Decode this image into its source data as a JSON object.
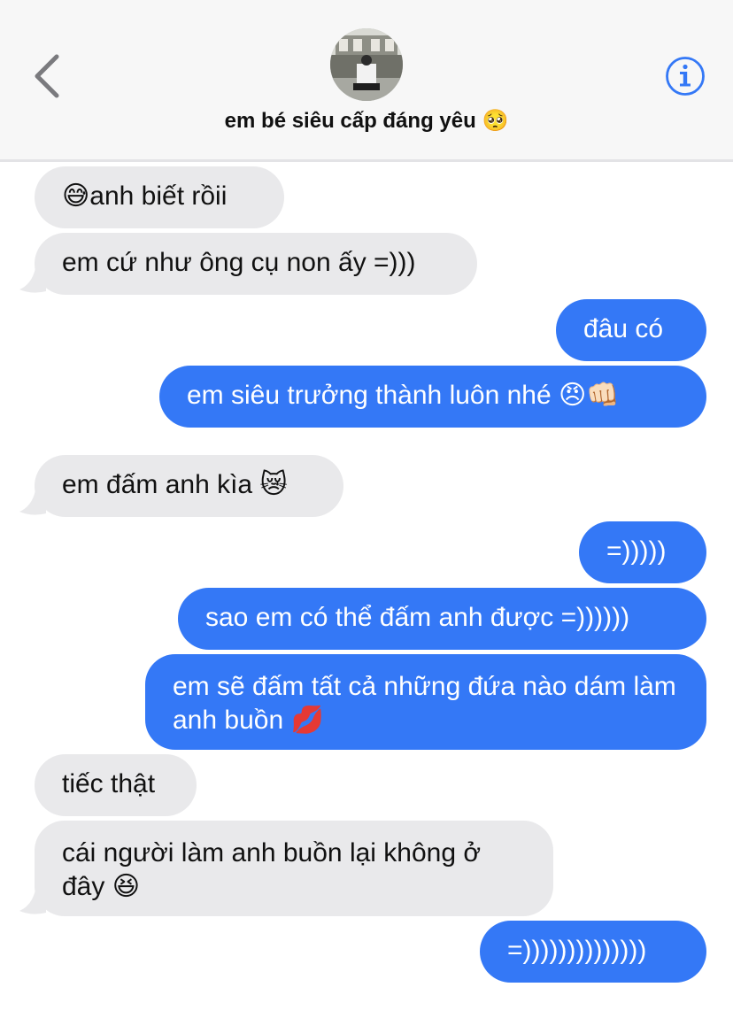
{
  "header": {
    "contact_name": "em bé siêu cấp đáng yêu 🥺",
    "back_icon": "chevron-left-icon",
    "info_icon": "info-icon",
    "accent_color": "#3478f6"
  },
  "messages": [
    {
      "from": "them",
      "text": "😅anh biết rồii"
    },
    {
      "from": "them",
      "text": "em cứ như ông cụ non ấy =)))"
    },
    {
      "from": "me",
      "text": "đâu có"
    },
    {
      "from": "me",
      "text": "em siêu trưởng thành luôn nhé 😠👊🏻"
    },
    {
      "from": "them",
      "text": "em đấm anh kìa 😿"
    },
    {
      "from": "me",
      "text": "=)))))"
    },
    {
      "from": "me",
      "text": "sao em có thể đấm anh được =))))))"
    },
    {
      "from": "me",
      "text": "em sẽ đấm tất cả những đứa nào dám làm anh buồn 💋"
    },
    {
      "from": "them",
      "text": "tiếc thật"
    },
    {
      "from": "them",
      "text": "cái người làm anh buồn lại không ở đây 😆"
    },
    {
      "from": "me",
      "text": "=))))))))))))))"
    }
  ],
  "colors": {
    "sent_bubble": "#3478f6",
    "received_bubble": "#e9e9eb",
    "header_bg": "#f7f7f7"
  }
}
